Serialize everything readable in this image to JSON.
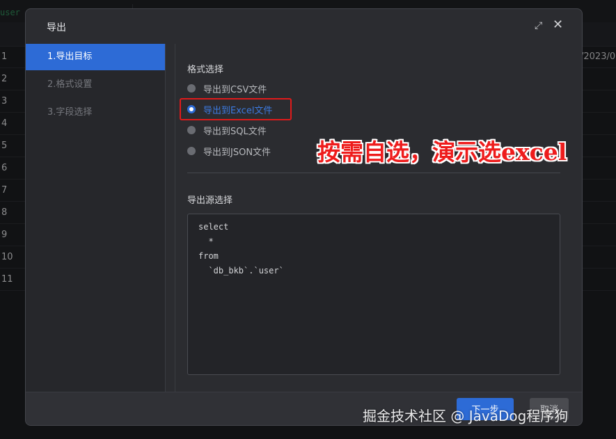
{
  "background": {
    "tab_label": "user",
    "row_numbers": [
      "1",
      "2",
      "3",
      "4",
      "5",
      "6",
      "7",
      "8",
      "9",
      "10",
      "11"
    ],
    "first_row_date": "/2023/0"
  },
  "dialog": {
    "title": "导出",
    "steps": [
      {
        "label": "1.导出目标",
        "active": true
      },
      {
        "label": "2.格式设置",
        "active": false
      },
      {
        "label": "3.字段选择",
        "active": false
      }
    ],
    "format_section_title": "格式选择",
    "formats": [
      {
        "label": "导出到CSV文件",
        "checked": false
      },
      {
        "label": "导出到Excel文件",
        "checked": true
      },
      {
        "label": "导出到SQL文件",
        "checked": false
      },
      {
        "label": "导出到JSON文件",
        "checked": false
      }
    ],
    "source_section_title": "导出源选择",
    "sql_lines": [
      "select",
      "  *",
      "from",
      "  `db_bkb`.`user`"
    ],
    "next_button": "下一步",
    "cancel_button": "取消"
  },
  "annotation": "按需自选，演示选excel",
  "watermark": "掘金技术社区 @ JavaDog程序狗",
  "colors": {
    "accent": "#2d6bd6",
    "annotation": "#ee1c1c",
    "highlight_border": "#e01a1a"
  }
}
